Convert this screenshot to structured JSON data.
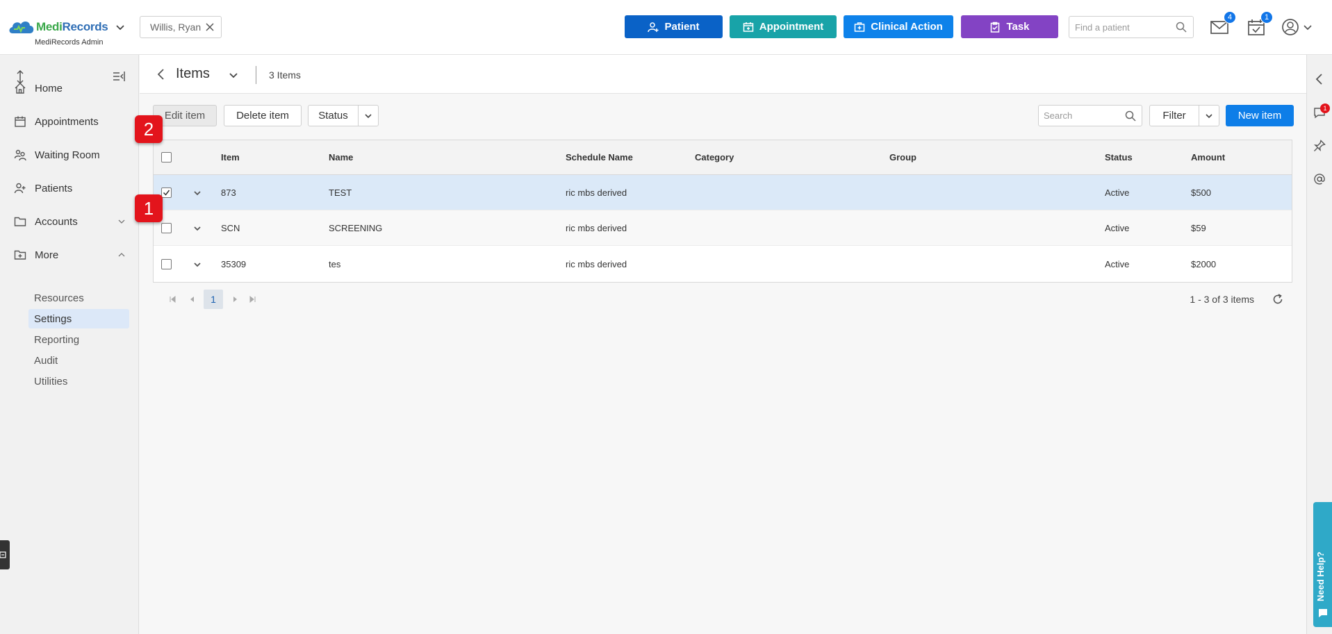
{
  "header": {
    "brand_medi": "Medi",
    "brand_records": "Records",
    "brand_sub": "MediRecords Admin",
    "patient_chip": "Willis, Ryan",
    "buttons": {
      "patient": "Patient",
      "appointment": "Appointment",
      "clinical_action": "Clinical Action",
      "task": "Task"
    },
    "find_placeholder": "Find a patient",
    "mail_badge": "4",
    "calendar_badge": "1"
  },
  "sidebar": {
    "items": [
      {
        "label": "Home",
        "icon": "home-icon"
      },
      {
        "label": "Appointments",
        "icon": "calendar-icon"
      },
      {
        "label": "Waiting Room",
        "icon": "people-icon"
      },
      {
        "label": "Patients",
        "icon": "person-icon"
      },
      {
        "label": "Accounts",
        "icon": "folder-icon"
      },
      {
        "label": "More",
        "icon": "folder-plus-icon"
      }
    ],
    "sub_items": [
      "Resources",
      "Settings",
      "Reporting",
      "Audit",
      "Utilities"
    ],
    "active_sub": "Settings"
  },
  "page": {
    "title": "Items",
    "count": "3 Items"
  },
  "toolbar": {
    "edit": "Edit item",
    "delete": "Delete item",
    "status": "Status",
    "search_placeholder": "Search",
    "filter": "Filter",
    "new": "New item"
  },
  "table": {
    "columns": {
      "item": "Item",
      "name": "Name",
      "schedule": "Schedule Name",
      "category": "Category",
      "group": "Group",
      "status": "Status",
      "amount": "Amount"
    },
    "rows": [
      {
        "item": "873",
        "name": "TEST",
        "schedule": "ric mbs derived",
        "category": "",
        "group": "",
        "status": "Active",
        "amount": "$500",
        "selected": true
      },
      {
        "item": "SCN",
        "name": "SCREENING",
        "schedule": "ric mbs derived",
        "category": "",
        "group": "",
        "status": "Active",
        "amount": "$59",
        "selected": false
      },
      {
        "item": "35309",
        "name": "tes",
        "schedule": "ric mbs derived",
        "category": "",
        "group": "",
        "status": "Active",
        "amount": "$2000",
        "selected": false
      }
    ]
  },
  "pager": {
    "page": "1",
    "info": "1 - 3 of 3 items"
  },
  "markers": {
    "one": "1",
    "two": "2"
  },
  "rail": {
    "chat_badge": "1",
    "help": "Need Help?"
  },
  "colors": {
    "patient": "#0a62c7",
    "appointment": "#18a3a8",
    "clinical_action": "#0e82ea",
    "task": "#8343c4",
    "primary": "#0e7ee8",
    "marker": "#e3141c"
  }
}
